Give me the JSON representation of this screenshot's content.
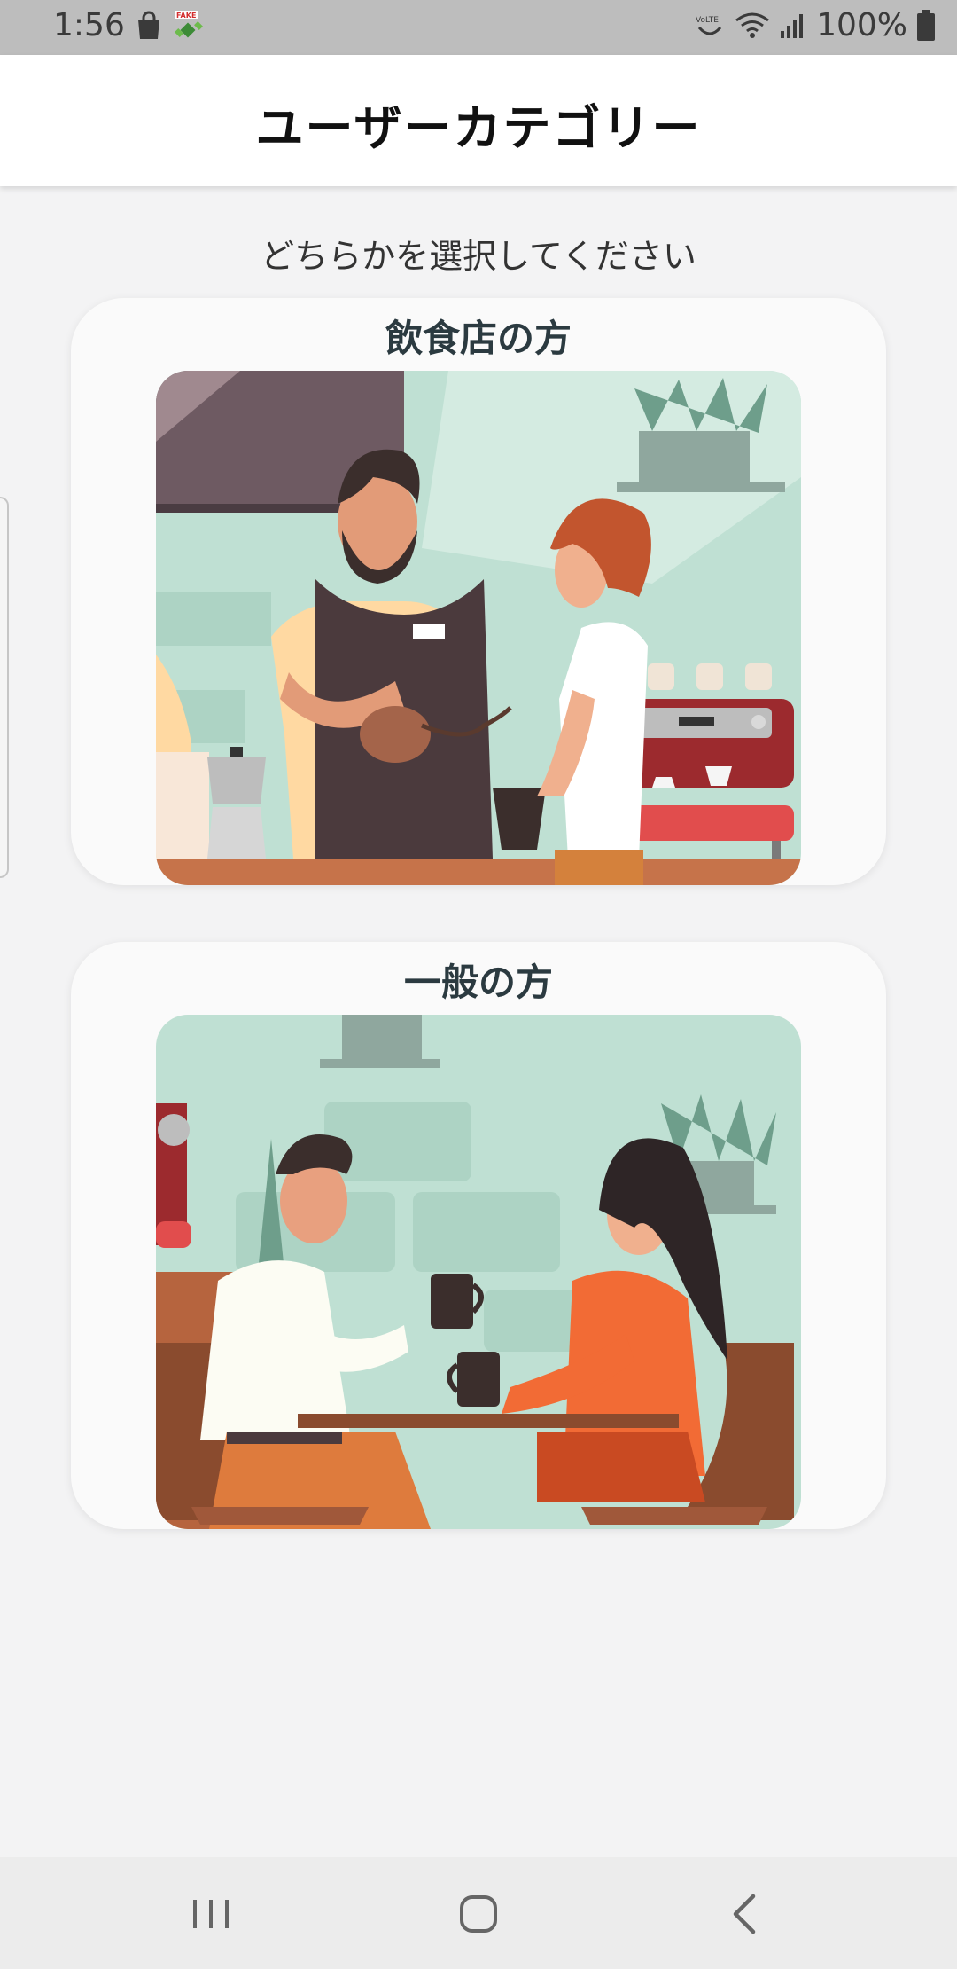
{
  "status_bar": {
    "time": "1:56",
    "battery": "100%",
    "left_icons": [
      "shopping-bag-icon",
      "fake-gps-icon"
    ],
    "right_icons": [
      "volte-icon",
      "wifi-icon",
      "signal-icon",
      "battery-icon"
    ]
  },
  "app_bar": {
    "title": "ユーザーカテゴリー"
  },
  "subtitle": "どちらかを選択してください",
  "categories": [
    {
      "title": "飲食店の方",
      "image": "barista-serving-customer-illustration"
    },
    {
      "title": "一般の方",
      "image": "couple-drinking-coffee-illustration"
    }
  ],
  "nav_bar": {
    "buttons": [
      "recent-apps-icon",
      "home-icon",
      "back-icon"
    ]
  },
  "colors": {
    "status_bar": "#bdbdbd",
    "app_bar": "#ffffff",
    "background": "#f3f3f4",
    "card": "#fafafa",
    "card_title": "#2b3a40",
    "illustration_bg": "#bfe0d3"
  }
}
